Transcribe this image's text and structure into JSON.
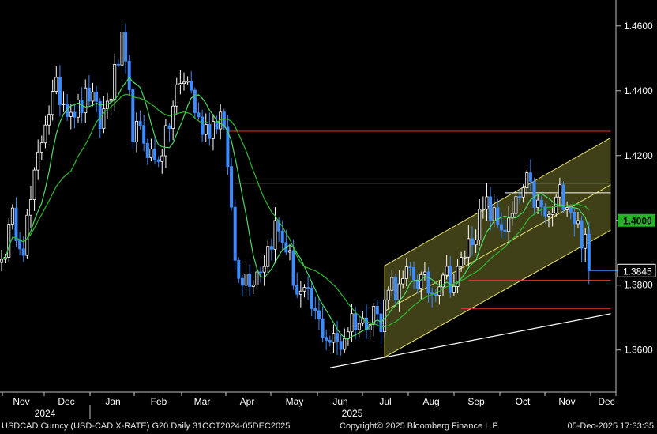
{
  "chart_data": {
    "type": "candlestick",
    "ylim": [
      1.347,
      1.468
    ],
    "grid": false,
    "y_ticks": [
      {
        "value": 1.36,
        "label": "1.3600"
      },
      {
        "value": 1.38,
        "label": "1.3800"
      },
      {
        "value": 1.4,
        "label": "1.4000"
      },
      {
        "value": 1.42,
        "label": "1.4200"
      },
      {
        "value": 1.44,
        "label": "1.4400"
      },
      {
        "value": 1.46,
        "label": "1.4600"
      }
    ],
    "x_months": [
      "Nov",
      "Dec",
      "Jan",
      "Feb",
      "Mar",
      "Apr",
      "May",
      "Jun",
      "Jul",
      "Aug",
      "Sep",
      "Oct",
      "Nov",
      "Dec"
    ],
    "x_years": [
      "2024",
      "2025"
    ],
    "price_labels": [
      {
        "value": 1.4,
        "label": "1.4000",
        "style": "green"
      },
      {
        "value": 1.3845,
        "label": "1.3845",
        "style": "white"
      }
    ],
    "sessions": 27,
    "anchors": [
      [
        0,
        1.388
      ],
      [
        3,
        1.4
      ],
      [
        6,
        1.393
      ],
      [
        9,
        1.412
      ],
      [
        12,
        1.432
      ],
      [
        15,
        1.44
      ],
      [
        18,
        1.436
      ],
      [
        21,
        1.434
      ],
      [
        24,
        1.439
      ],
      [
        27,
        1.43
      ],
      [
        30,
        1.44
      ],
      [
        33,
        1.454
      ],
      [
        36,
        1.428
      ],
      [
        39,
        1.425
      ],
      [
        42,
        1.418
      ],
      [
        45,
        1.425
      ],
      [
        48,
        1.44
      ],
      [
        51,
        1.444
      ],
      [
        54,
        1.43
      ],
      [
        57,
        1.429
      ],
      [
        60,
        1.432
      ],
      [
        62,
        1.418
      ],
      [
        64,
        1.388
      ],
      [
        66,
        1.383
      ],
      [
        69,
        1.383
      ],
      [
        72,
        1.388
      ],
      [
        75,
        1.398
      ],
      [
        78,
        1.392
      ],
      [
        81,
        1.378
      ],
      [
        84,
        1.375
      ],
      [
        87,
        1.368
      ],
      [
        90,
        1.363
      ],
      [
        93,
        1.362
      ],
      [
        96,
        1.37
      ],
      [
        99,
        1.368
      ],
      [
        102,
        1.374
      ],
      [
        104,
        1.366
      ],
      [
        106,
        1.382
      ],
      [
        109,
        1.378
      ],
      [
        112,
        1.384
      ],
      [
        115,
        1.381
      ],
      [
        118,
        1.378
      ],
      [
        121,
        1.385
      ],
      [
        124,
        1.38
      ],
      [
        127,
        1.39
      ],
      [
        130,
        1.398
      ],
      [
        133,
        1.404
      ],
      [
        136,
        1.399
      ],
      [
        139,
        1.398
      ],
      [
        142,
        1.407
      ],
      [
        144,
        1.411
      ],
      [
        147,
        1.404
      ],
      [
        150,
        1.4
      ],
      [
        153,
        1.408
      ],
      [
        155,
        1.407
      ],
      [
        158,
        1.398
      ],
      [
        160,
        1.392
      ],
      [
        161,
        1.3845
      ]
    ],
    "lines": [
      {
        "kind": "horizontal",
        "color": "#e53935",
        "y": 1.4275,
        "x0": 62,
        "x1": 167
      },
      {
        "kind": "horizontal",
        "color": "#ffffff",
        "y": 1.4115,
        "x0": 64,
        "x1": 167
      },
      {
        "kind": "horizontal",
        "color": "#ffffff",
        "y": 1.4085,
        "x0": 138,
        "x1": 167
      },
      {
        "kind": "horizontal",
        "color": "#e53935",
        "y": 1.3815,
        "x0": 128,
        "x1": 167
      },
      {
        "kind": "horizontal",
        "color": "#e53935",
        "y": 1.3728,
        "x0": 126,
        "x1": 167
      },
      {
        "kind": "trend",
        "color": "#ffffff",
        "x0": 90,
        "y0": 1.3545,
        "x1": 167,
        "y1": 1.3712
      }
    ],
    "channel": {
      "fill": "#4a4a1c",
      "stroke": "#e8e070",
      "upper": [
        [
          105,
          1.386
        ],
        [
          167,
          1.4255
        ]
      ],
      "middle": [
        [
          105,
          1.372
        ],
        [
          167,
          1.411
        ]
      ],
      "lower": [
        [
          105,
          1.3578
        ],
        [
          167,
          1.397
        ]
      ]
    },
    "ma_fast_period": 8,
    "ma_slow_period": 20
  },
  "footer": {
    "description": "USDCAD Curncy (USD-CAD X-RATE) G20 Daily 31OCT2024-05DEC2025",
    "copyright": "Copyright© 2025 Bloomberg Finance L.P.",
    "datetime": "05-Dec-2025 17:33:35"
  }
}
